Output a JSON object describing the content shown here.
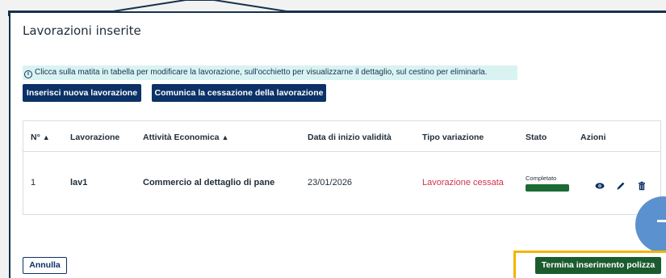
{
  "section": {
    "title": "Lavorazioni inserite",
    "info": "Clicca sulla matita in tabella per modificare la lavorazione, sull'occhietto per visualizzarne il dettaglio, sul cestino per eliminarla."
  },
  "buttons": {
    "new_label": "Inserisci nuova lavorazione",
    "cease_label": "Comunica la cessazione della lavorazione",
    "cancel_label": "Annulla",
    "finish_label": "Termina inserimento polizza"
  },
  "table": {
    "headers": {
      "num": "N°",
      "lavorazione": "Lavorazione",
      "attivita": "Attività Economica",
      "data": "Data di inizio validità",
      "tipo": "Tipo variazione",
      "stato": "Stato",
      "azioni": "Azioni"
    },
    "rows": [
      {
        "num": "1",
        "lavorazione": "lav1",
        "attivita": "Commercio al dettaglio di pane",
        "data": "23/01/2026",
        "tipo": "Lavorazione cessata",
        "stato": "Completato"
      }
    ]
  },
  "colors": {
    "primary": "#0b3166",
    "success": "#1c5b2e",
    "danger": "#d1344c",
    "highlight": "#f5b400",
    "info_bg": "#d9f3f2"
  },
  "icons": [
    "info-icon",
    "sort-icon",
    "eye-icon",
    "pencil-icon",
    "trash-icon"
  ]
}
